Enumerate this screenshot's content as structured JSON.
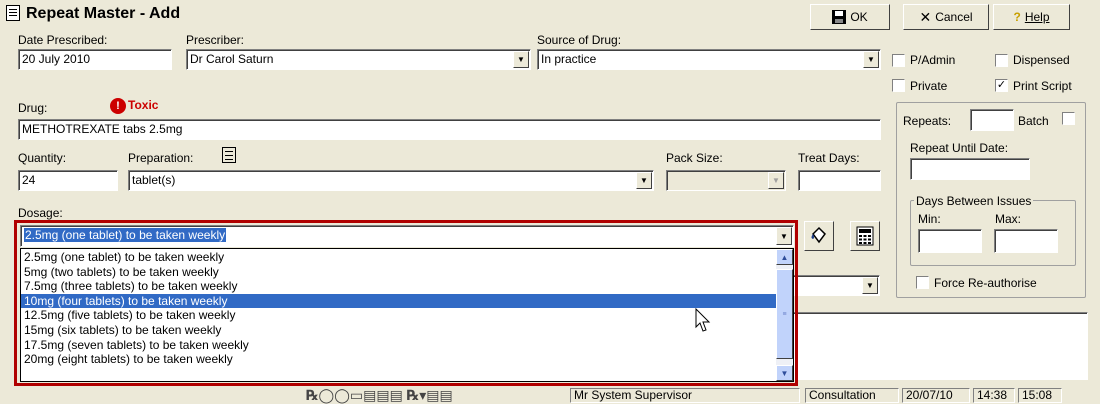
{
  "window": {
    "title": "Repeat Master - Add",
    "ok_label": "OK",
    "cancel_label": "Cancel",
    "help_label": "Help"
  },
  "form": {
    "date_prescribed": {
      "label": "Date Prescribed:",
      "value": "20 July 2010"
    },
    "prescriber": {
      "label": "Prescriber:",
      "value": "Dr Carol Saturn"
    },
    "source_of_drug": {
      "label": "Source of Drug:",
      "value": "In practice"
    },
    "drug": {
      "label": "Drug:",
      "value": "METHOTREXATE tabs 2.5mg",
      "toxic_label": "Toxic"
    },
    "quantity": {
      "label": "Quantity:",
      "value": "24"
    },
    "preparation": {
      "label": "Preparation:",
      "value": "tablet(s)"
    },
    "pack_size": {
      "label": "Pack Size:",
      "value": ""
    },
    "treat_days": {
      "label": "Treat Days:",
      "value": ""
    },
    "dosage": {
      "label": "Dosage:",
      "value": "2.5mg (one tablet) to be taken weekly"
    }
  },
  "dosage_options": [
    "2.5mg (one tablet) to be taken weekly",
    "5mg (two tablets) to be taken weekly",
    "7.5mg (three tablets) to be taken weekly",
    "10mg (four tablets) to be taken weekly",
    "12.5mg (five tablets) to be taken weekly",
    "15mg (six tablets) to be taken weekly",
    "17.5mg (seven tablets) to be taken weekly",
    "20mg (eight tablets) to be taken weekly"
  ],
  "dosage_selected_index": 3,
  "options": {
    "p_admin": {
      "label": "P/Admin",
      "checked": false
    },
    "dispensed": {
      "label": "Dispensed",
      "checked": false
    },
    "private": {
      "label": "Private",
      "checked": false
    },
    "print_script": {
      "label": "Print Script",
      "checked": true
    },
    "repeats_label": "Repeats:",
    "batch_label": "Batch",
    "repeat_until_label": "Repeat Until Date:",
    "days_between_label": "Days Between Issues",
    "min_label": "Min:",
    "max_label": "Max:",
    "force_reauth": {
      "label": "Force Re-authorise",
      "checked": false
    }
  },
  "statusbar": {
    "user": "Mr System Supervisor",
    "mode": "Consultation",
    "date": "20/07/10",
    "time1": "14:38",
    "time2": "15:08"
  },
  "colors": {
    "selection": "#316ac5",
    "highlight_border": "#b00000",
    "toxic": "#cc0000"
  }
}
